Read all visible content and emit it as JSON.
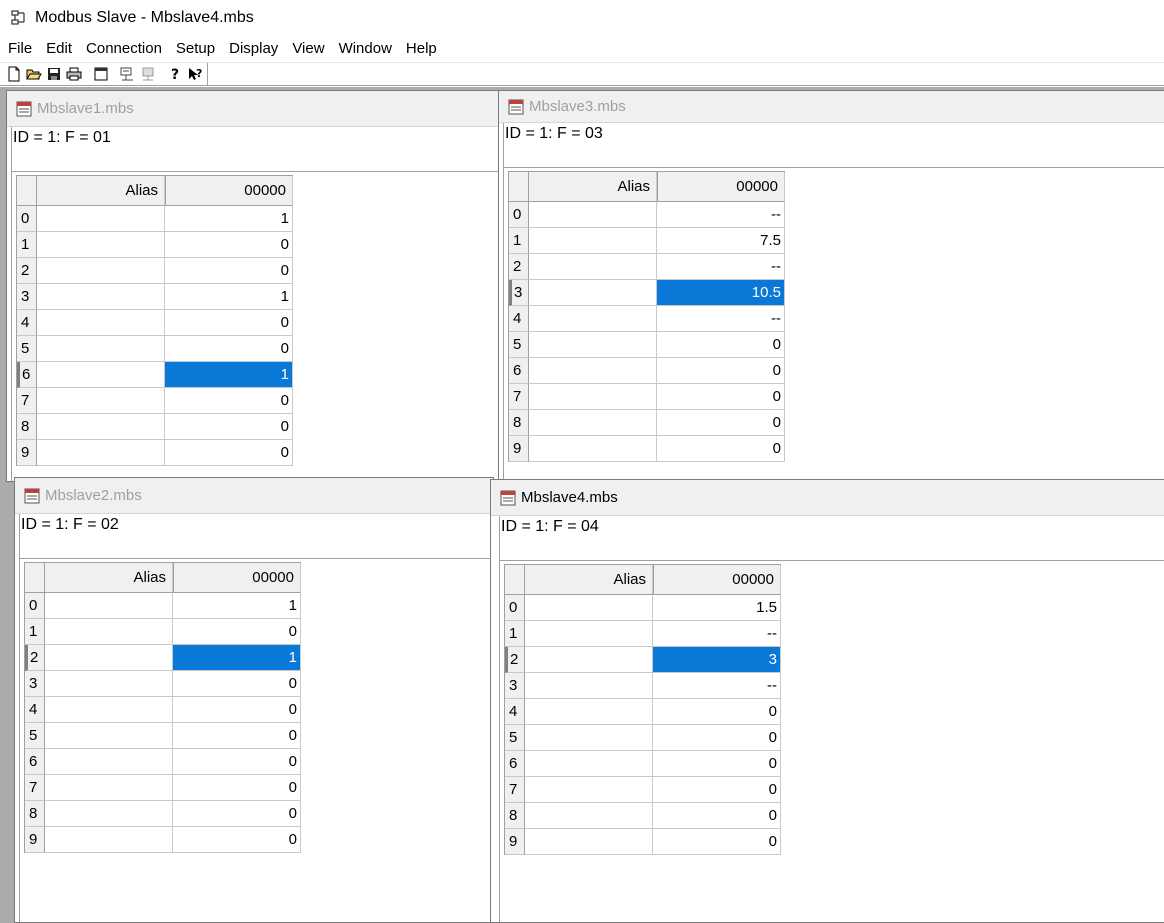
{
  "app": {
    "title": "Modbus Slave - Mbslave4.mbs",
    "icon": "modbus-app-icon"
  },
  "menu": [
    "File",
    "Edit",
    "Connection",
    "Setup",
    "Display",
    "View",
    "Window",
    "Help"
  ],
  "toolbar": {
    "buttons": [
      "new-icon",
      "open-icon",
      "save-icon",
      "print-icon",
      "window-icon",
      "connect-icon",
      "disconnect-icon",
      "help-icon",
      "context-help-icon"
    ]
  },
  "windows": [
    {
      "name": "Mbslave1.mbs",
      "info": "ID = 1: F = 01",
      "alias_header": "Alias",
      "col_header": "00000",
      "rows": [
        "0",
        "1",
        "2",
        "3",
        "4",
        "5",
        "6",
        "7",
        "8",
        "9"
      ],
      "values": [
        "1",
        "0",
        "0",
        "1",
        "0",
        "0",
        "1",
        "0",
        "0",
        "0"
      ],
      "selected_row": 6,
      "active": false
    },
    {
      "name": "Mbslave3.mbs",
      "info": "ID = 1: F = 03",
      "alias_header": "Alias",
      "col_header": "00000",
      "rows": [
        "0",
        "1",
        "2",
        "3",
        "4",
        "5",
        "6",
        "7",
        "8",
        "9"
      ],
      "values": [
        "--",
        "7.5",
        "--",
        "10.5",
        "--",
        "0",
        "0",
        "0",
        "0",
        "0"
      ],
      "selected_row": 3,
      "active": false
    },
    {
      "name": "Mbslave2.mbs",
      "info": "ID = 1: F = 02",
      "alias_header": "Alias",
      "col_header": "00000",
      "rows": [
        "0",
        "1",
        "2",
        "3",
        "4",
        "5",
        "6",
        "7",
        "8",
        "9"
      ],
      "values": [
        "1",
        "0",
        "1",
        "0",
        "0",
        "0",
        "0",
        "0",
        "0",
        "0"
      ],
      "selected_row": 2,
      "active": false
    },
    {
      "name": "Mbslave4.mbs",
      "info": "ID = 1: F = 04",
      "alias_header": "Alias",
      "col_header": "00000",
      "rows": [
        "0",
        "1",
        "2",
        "3",
        "4",
        "5",
        "6",
        "7",
        "8",
        "9"
      ],
      "values": [
        "1.5",
        "--",
        "3",
        "--",
        "0",
        "0",
        "0",
        "0",
        "0",
        "0"
      ],
      "selected_row": 2,
      "active": true
    }
  ]
}
